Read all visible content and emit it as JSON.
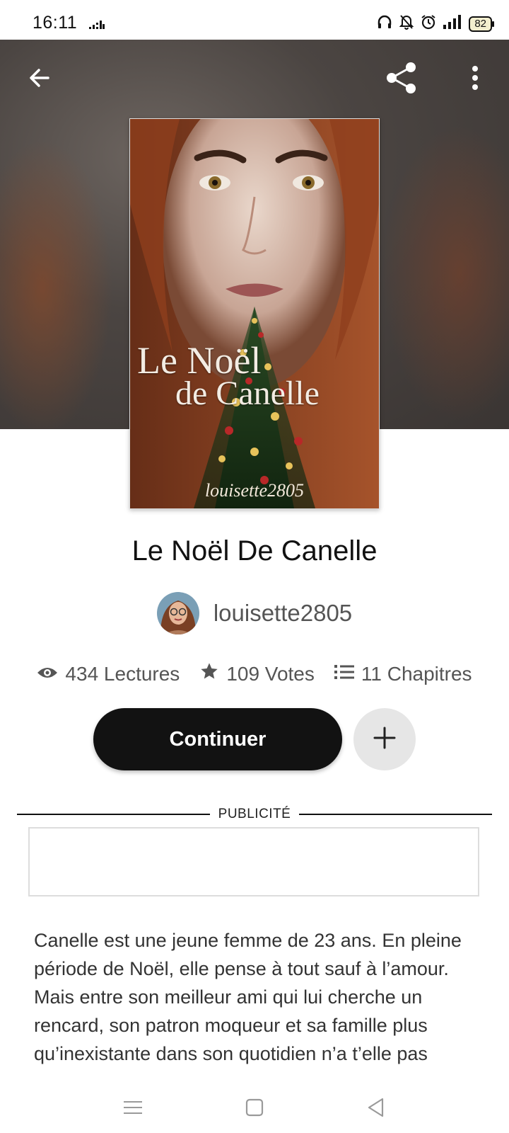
{
  "status_bar": {
    "time": "16:11",
    "battery": "82",
    "icons": [
      "activity-icon",
      "headphones-icon",
      "bell-off-icon",
      "alarm-icon",
      "signal-icon",
      "battery-icon"
    ]
  },
  "top_bar": {
    "back_icon": "arrow-left-icon",
    "share_icon": "share-icon",
    "more_icon": "more-vertical-icon"
  },
  "cover": {
    "title_line1": "Le Noël",
    "title_line2": "de Canelle",
    "author": "louisette2805"
  },
  "book": {
    "title": "Le Noël De Canelle",
    "author": "louisette2805"
  },
  "stats": {
    "reads": "434 Lectures",
    "votes": "109 Votes",
    "chapters": "11 Chapitres"
  },
  "actions": {
    "continue_label": "Continuer",
    "add_icon": "plus-icon"
  },
  "ad": {
    "label": "PUBLICITÉ"
  },
  "description": "Canelle est une jeune femme de 23 ans. En pleine période de Noël, elle pense à tout sauf à l’amour. Mais entre son meilleur ami qui lui cherche un rencard, son patron moqueur et sa famille plus qu’inexistante dans son quotidien n’a t’elle pas",
  "navbar": {
    "items": [
      "menu-icon",
      "home-icon",
      "back-icon"
    ]
  }
}
